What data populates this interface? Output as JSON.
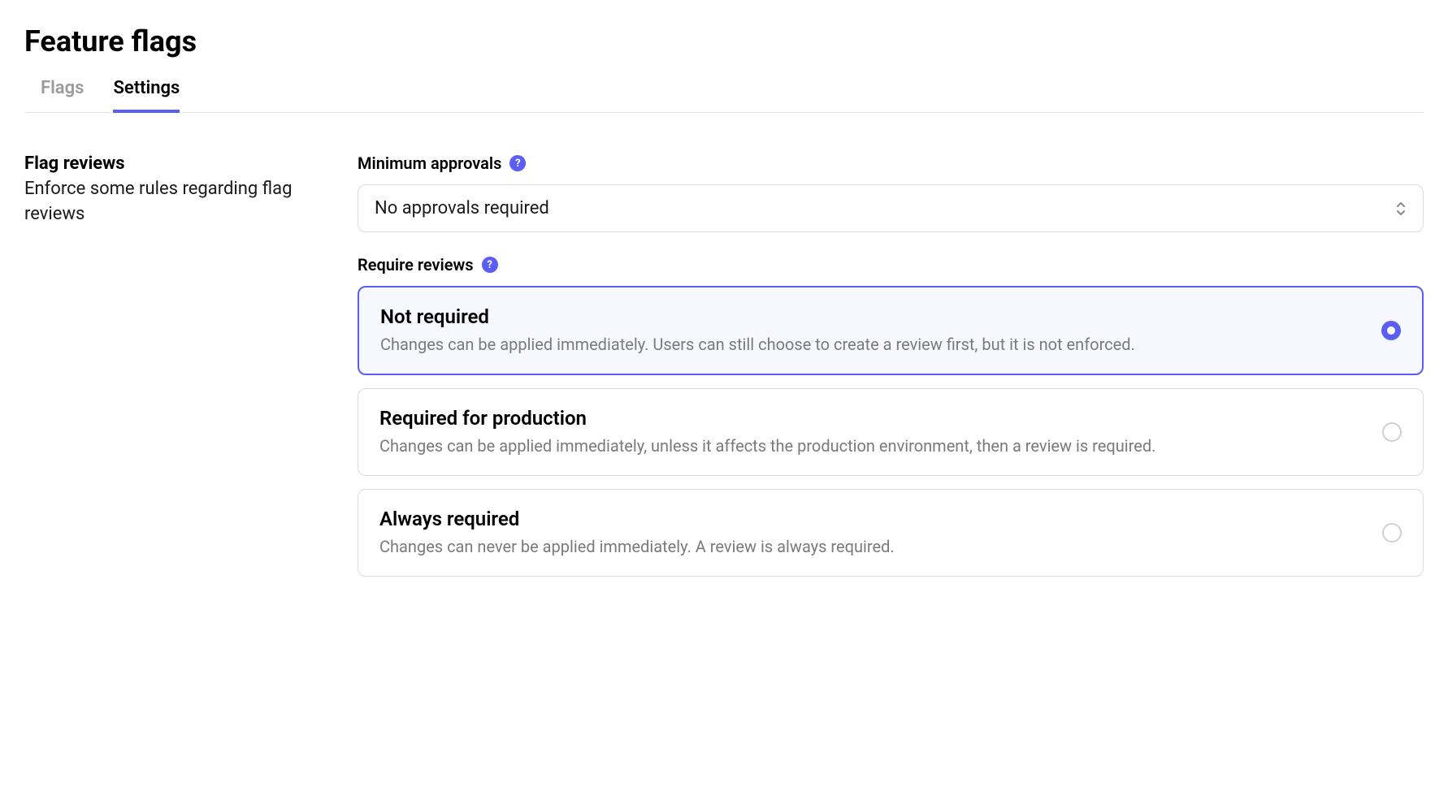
{
  "page": {
    "title": "Feature flags"
  },
  "tabs": [
    {
      "label": "Flags",
      "active": false
    },
    {
      "label": "Settings",
      "active": true
    }
  ],
  "section": {
    "title": "Flag reviews",
    "description": "Enforce some rules regarding flag reviews"
  },
  "fields": {
    "minApprovals": {
      "label": "Minimum approvals",
      "value": "No approvals required"
    },
    "requireReviews": {
      "label": "Require reviews",
      "options": [
        {
          "title": "Not required",
          "description": "Changes can be applied immediately. Users can still choose to create a review first, but it is not enforced.",
          "selected": true
        },
        {
          "title": "Required for production",
          "description": "Changes can be applied immediately, unless it affects the production environment, then a review is required.",
          "selected": false
        },
        {
          "title": "Always required",
          "description": "Changes can never be applied immediately. A review is always required.",
          "selected": false
        }
      ]
    }
  }
}
